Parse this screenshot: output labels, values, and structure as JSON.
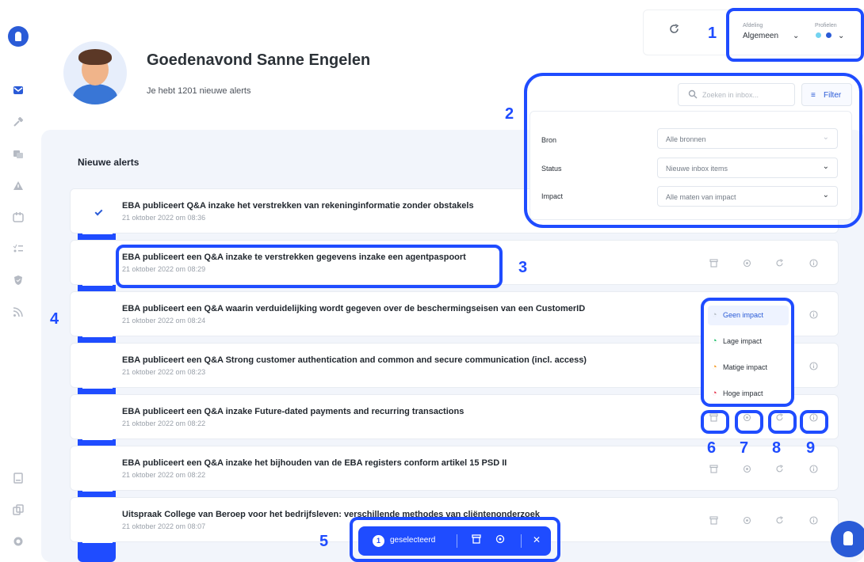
{
  "header": {
    "greeting": "Goedenavond Sanne Engelen",
    "subtitle": "Je hebt 1201 nieuwe alerts"
  },
  "top_filters": {
    "department_label": "Afdeling",
    "department_value": "Algemeen",
    "profiles_label": "Profielen",
    "profile_dot_colors": [
      "#73d3f0",
      "#2a5bd7"
    ]
  },
  "search": {
    "placeholder": "Zoeken in inbox...",
    "filter_label": "Filter"
  },
  "filter_panel": {
    "rows": [
      {
        "label": "Bron",
        "value": "Alle bronnen"
      },
      {
        "label": "Status",
        "value": "Nieuwe inbox items"
      },
      {
        "label": "Impact",
        "value": "Alle maten van impact"
      }
    ]
  },
  "main": {
    "section_title": "Nieuwe alerts",
    "alerts": [
      {
        "title": "EBA publiceert Q&A inzake het verstrekken van rekeninginformatie zonder obstakels",
        "date": "21 oktober 2022 om 08:36",
        "checked": true
      },
      {
        "title": "EBA publiceert een Q&A inzake te verstrekken gegevens inzake een agentpaspoort",
        "date": "21 oktober 2022 om 08:29",
        "checked": false
      },
      {
        "title": "EBA publiceert een Q&A waarin verduidelijking wordt gegeven over de beschermingseisen van een CustomerID",
        "date": "21 oktober 2022 om 08:24",
        "checked": false
      },
      {
        "title": "EBA publiceert een Q&A Strong customer authentication and common and secure communication (incl. access)",
        "date": "21 oktober 2022 om 08:23",
        "checked": false
      },
      {
        "title": "EBA publiceert een Q&A inzake Future-dated payments and recurring transactions",
        "date": "21 oktober 2022 om 08:22",
        "checked": false
      },
      {
        "title": "EBA publiceert een Q&A inzake het bijhouden van de EBA registers conform artikel 15 PSD II",
        "date": "21 oktober 2022 om 08:22",
        "checked": false
      },
      {
        "title": "Uitspraak College van Beroep voor het bedrijfsleven: verschillende methodes van cliëntenonderzoek",
        "date": "21 oktober 2022 om 08:07",
        "checked": false
      }
    ]
  },
  "impact_menu": {
    "items": [
      {
        "label": "Geen impact",
        "color": "#b9bfc8"
      },
      {
        "label": "Lage impact",
        "color": "#1fbf6a"
      },
      {
        "label": "Matige impact",
        "color": "#f59a23"
      },
      {
        "label": "Hoge impact",
        "color": "#e5304a"
      }
    ]
  },
  "selection_bar": {
    "count": "1",
    "label": "geselecteerd"
  },
  "annotations": {
    "n1": "1",
    "n2": "2",
    "n3": "3",
    "n4": "4",
    "n5": "5",
    "n6": "6",
    "n7": "7",
    "n8": "8",
    "n9": "9"
  }
}
